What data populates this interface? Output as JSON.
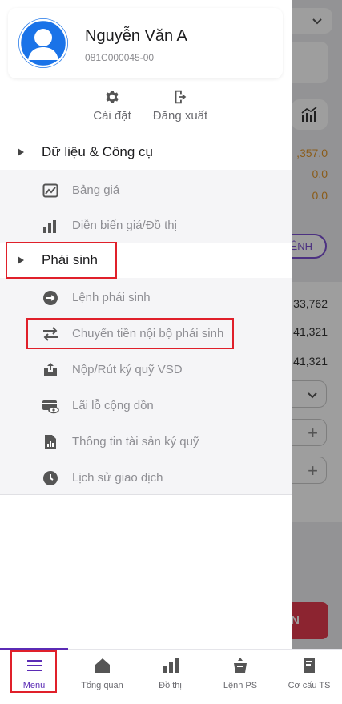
{
  "profile": {
    "name": "Nguyễn Văn A",
    "account_id": "081C000045-00"
  },
  "quick_actions": {
    "settings": "Cài đặt",
    "logout": "Đăng xuất"
  },
  "sections": {
    "data_tools": {
      "label": "Dữ liệu & Công cụ",
      "items": [
        {
          "label": "Bảng giá",
          "icon": "price-board-icon"
        },
        {
          "label": "Diễn biến giá/Đồ thị",
          "icon": "chart-icon"
        }
      ]
    },
    "derivatives": {
      "label": "Phái sinh",
      "items": [
        {
          "label": "Lệnh phái sinh",
          "icon": "arrow-right-circle-icon"
        },
        {
          "label": "Chuyển tiền nội bộ phái sinh",
          "icon": "transfer-arrows-icon"
        },
        {
          "label": "Nộp/Rút ký quỹ VSD",
          "icon": "upload-tray-icon"
        },
        {
          "label": "Lãi lỗ cộng dồn",
          "icon": "card-eye-icon"
        },
        {
          "label": "Thông tin tài sản ký quỹ",
          "icon": "document-chart-icon"
        },
        {
          "label": "Lịch sử giao dịch",
          "icon": "clock-icon"
        }
      ]
    }
  },
  "background": {
    "values": [
      ",357.0",
      "0.0",
      "0.0",
      "33,762",
      "41,321",
      "41,321"
    ],
    "order_button": "ỆNH",
    "submit_button": "N"
  },
  "tabbar": {
    "tabs": [
      {
        "label": "Menu",
        "icon": "menu-icon"
      },
      {
        "label": "Tổng quan",
        "icon": "home-icon"
      },
      {
        "label": "Đồ thị",
        "icon": "chart-icon"
      },
      {
        "label": "Lệnh PS",
        "icon": "order-bag-icon"
      },
      {
        "label": "Cơ cấu TS",
        "icon": "book-icon"
      }
    ]
  },
  "colors": {
    "accent": "#5b2bb5",
    "highlight_box": "#e0202a",
    "avatar": "#1a73e8",
    "value_orange": "#e0952a",
    "submit_red": "#e23b4e"
  }
}
